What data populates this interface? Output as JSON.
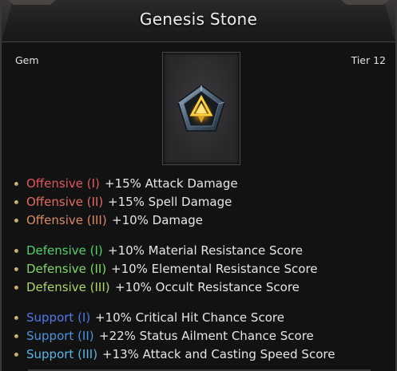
{
  "item": {
    "name": "Genesis Stone",
    "type": "Gem",
    "tier": "Tier 12",
    "icon": "gem-icon"
  },
  "stat_groups": [
    {
      "name": "offensive",
      "stats": [
        {
          "tier_name": "Offensive (I)",
          "effect": "+15% Attack Damage",
          "color": "#e3565f"
        },
        {
          "tier_name": "Offensive (II)",
          "effect": "+15% Spell Damage",
          "color": "#e36c5f"
        },
        {
          "tier_name": "Offensive (III)",
          "effect": "+10% Damage",
          "color": "#d98b62"
        }
      ]
    },
    {
      "name": "defensive",
      "stats": [
        {
          "tier_name": "Defensive (I)",
          "effect": "+10% Material Resistance Score",
          "color": "#4ed36a"
        },
        {
          "tier_name": "Defensive (II)",
          "effect": "+10% Elemental Resistance Score",
          "color": "#80d860"
        },
        {
          "tier_name": "Defensive (III)",
          "effect": "+10% Occult Resistance Score",
          "color": "#b0d662"
        }
      ]
    },
    {
      "name": "support",
      "stats": [
        {
          "tier_name": "Support (I)",
          "effect": "+10% Critical Hit Chance Score",
          "color": "#4f79ea"
        },
        {
          "tier_name": "Support (II)",
          "effect": "+22% Status Ailment Chance Score",
          "color": "#4a94e0"
        },
        {
          "tier_name": "Support (III)",
          "effect": "+13% Attack and Casting Speed Score",
          "color": "#5bb5e6"
        }
      ]
    }
  ]
}
